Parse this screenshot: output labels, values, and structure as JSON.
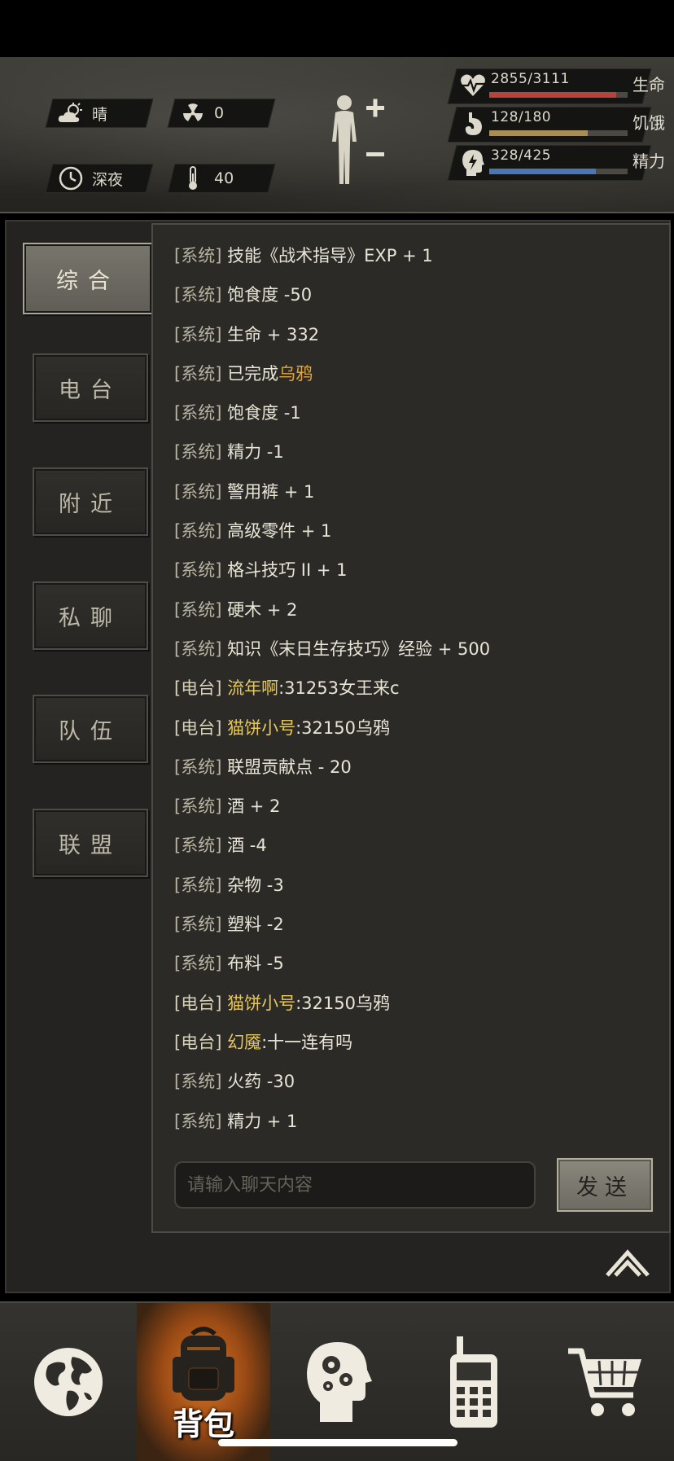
{
  "header": {
    "weather": "晴",
    "radiation": "0",
    "time_of_day": "深夜",
    "temperature": "40",
    "vitals": [
      {
        "value": "2855/3111",
        "label": "生命",
        "fill": 0.918,
        "color": "#b8433b",
        "icon": "heart-pulse-icon"
      },
      {
        "value": "128/180",
        "label": "饥饿",
        "fill": 0.711,
        "color": "#a88d55",
        "icon": "stomach-icon"
      },
      {
        "value": "328/425",
        "label": "精力",
        "fill": 0.772,
        "color": "#4a76b5",
        "icon": "energy-head-icon"
      }
    ],
    "body_icon": "body-figure-icon"
  },
  "tabs": [
    {
      "label": "综合",
      "active": true
    },
    {
      "label": "电台",
      "active": false
    },
    {
      "label": "附近",
      "active": false
    },
    {
      "label": "私聊",
      "active": false
    },
    {
      "label": "队伍",
      "active": false
    },
    {
      "label": "联盟",
      "active": false
    }
  ],
  "chat": {
    "messages": [
      {
        "type": "system",
        "tag": "[系统]",
        "text": "技能《战术指导》EXP + 1"
      },
      {
        "type": "system",
        "tag": "[系统]",
        "text": "饱食度 -50"
      },
      {
        "type": "system",
        "tag": "[系统]",
        "text": "生命 + 332"
      },
      {
        "type": "system",
        "tag": "[系统]",
        "text": "已完成",
        "highlight": "乌鸦"
      },
      {
        "type": "system",
        "tag": "[系统]",
        "text": "饱食度 -1"
      },
      {
        "type": "system",
        "tag": "[系统]",
        "text": "精力 -1"
      },
      {
        "type": "system",
        "tag": "[系统]",
        "text": "警用裤 + 1"
      },
      {
        "type": "system",
        "tag": "[系统]",
        "text": "高级零件 + 1"
      },
      {
        "type": "system",
        "tag": "[系统]",
        "text": "格斗技巧 II + 1"
      },
      {
        "type": "system",
        "tag": "[系统]",
        "text": "硬木 + 2"
      },
      {
        "type": "system",
        "tag": "[系统]",
        "text": "知识《末日生存技巧》经验 + 500"
      },
      {
        "type": "radio",
        "tag": "[电台]",
        "name": "流年啊",
        "text": ":31253女王来c"
      },
      {
        "type": "radio",
        "tag": "[电台]",
        "name": "猫饼小号",
        "text": ":32150乌鸦"
      },
      {
        "type": "system",
        "tag": "[系统]",
        "text": "联盟贡献点 - 20"
      },
      {
        "type": "system",
        "tag": "[系统]",
        "text": "酒 + 2"
      },
      {
        "type": "system",
        "tag": "[系统]",
        "text": "酒 -4"
      },
      {
        "type": "system",
        "tag": "[系统]",
        "text": "杂物 -3"
      },
      {
        "type": "system",
        "tag": "[系统]",
        "text": "塑料 -2"
      },
      {
        "type": "system",
        "tag": "[系统]",
        "text": "布料 -5"
      },
      {
        "type": "radio",
        "tag": "[电台]",
        "name": "猫饼小号",
        "text": ":32150乌鸦"
      },
      {
        "type": "radio",
        "tag": "[电台]",
        "name": "幻魇",
        "text": ":十一连有吗"
      },
      {
        "type": "system",
        "tag": "[系统]",
        "text": "火药 -30"
      },
      {
        "type": "system",
        "tag": "[系统]",
        "text": "精力 + 1"
      }
    ],
    "input_placeholder": "请输入聊天内容",
    "send_label": "发送"
  },
  "bottom_nav": [
    {
      "icon": "globe-icon",
      "label": "",
      "active": false
    },
    {
      "icon": "backpack-icon",
      "label": "背包",
      "active": true
    },
    {
      "icon": "head-gears-icon",
      "label": "",
      "active": false
    },
    {
      "icon": "radio-phone-icon",
      "label": "",
      "active": false
    },
    {
      "icon": "shopping-cart-icon",
      "label": "",
      "active": false
    }
  ]
}
